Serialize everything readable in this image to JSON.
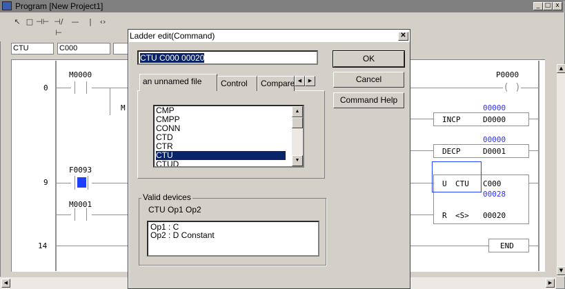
{
  "main_window": {
    "title": "Program  [New Project1]",
    "field_1": "CTU",
    "field_2": "C000",
    "sys_buttons": [
      "_",
      "□",
      "x"
    ]
  },
  "ladder": {
    "steps": [
      "0",
      "9",
      "14"
    ],
    "contacts": [
      "M0000",
      "F0093",
      "M0001"
    ],
    "truncated_label": "M",
    "coil_label": "P0000",
    "incp": {
      "op": "INCP",
      "value": "00000",
      "dev": "D0000"
    },
    "decp": {
      "op": "DECP",
      "value": "00000",
      "dev": "D0001"
    },
    "ctu": {
      "u": "U",
      "op": "CTU",
      "dev": "C000",
      "value": "00028",
      "r": "R",
      "s": "<S>",
      "preset": "00020"
    },
    "end": "END"
  },
  "dialog": {
    "title": "Ladder edit(Command)",
    "command_value": "CTU C000 00020",
    "ok_label": "OK",
    "cancel_label": "Cancel",
    "help_label": "Command Help",
    "tabs": [
      "an unnamed file",
      "Control",
      "Compare"
    ],
    "list_items": [
      "CMP",
      "CMPP",
      "CONN",
      "CTD",
      "CTR",
      "CTU",
      "CTUD"
    ],
    "selected_item": "CTU",
    "valid_devices_label": "Valid devices",
    "syntax": "CTU Op1 Op2",
    "operands": [
      "Op1 : C",
      "Op2 : D Constant"
    ]
  },
  "colors": {
    "selection": "#0a246a",
    "value_blue": "#3030ff",
    "face": "#d4d0c8"
  },
  "icons": [
    "pointer-icon",
    "select-box-icon",
    "contact-no-icon",
    "contact-nc-icon",
    "hline-icon",
    "vline-icon",
    "coil-icon",
    "close-icon",
    "arrow-left-icon",
    "arrow-right-icon",
    "arrow-up-icon",
    "arrow-down-icon"
  ]
}
